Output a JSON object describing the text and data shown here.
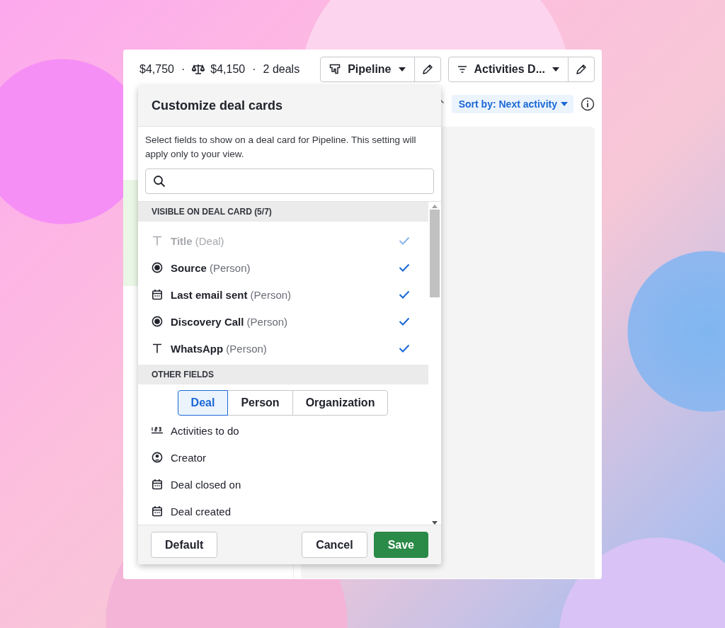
{
  "toolbar": {
    "summary": [
      {
        "text": "$4,750",
        "kind": "plain"
      },
      {
        "text": "$4,150",
        "kind": "weighted"
      },
      {
        "text": "2 deals",
        "kind": "plain"
      }
    ],
    "separators": [
      "·",
      "·"
    ],
    "view_button": {
      "label": "Pipeline"
    },
    "filter_button": {
      "label": "Activities D..."
    }
  },
  "sort": {
    "label": "Sort by: Next activity"
  },
  "dialog": {
    "title": "Customize deal cards",
    "description": "Select fields to show on a deal card for Pipeline. This setting will apply only to your view.",
    "visible_heading": "VISIBLE ON DEAL CARD (5/7)",
    "visible_fields": [
      {
        "name": "Title",
        "source": "(Deal)",
        "kind": "text",
        "checked": true,
        "disabled": true
      },
      {
        "name": "Source",
        "source": "(Person)",
        "kind": "option",
        "checked": true,
        "disabled": false
      },
      {
        "name": "Last email sent",
        "source": "(Person)",
        "kind": "date",
        "checked": true,
        "disabled": false
      },
      {
        "name": "Discovery Call",
        "source": "(Person)",
        "kind": "option",
        "checked": true,
        "disabled": false
      },
      {
        "name": "WhatsApp",
        "source": "(Person)",
        "kind": "text",
        "checked": true,
        "disabled": false
      }
    ],
    "other_heading": "OTHER FIELDS",
    "tabs": [
      {
        "label": "Deal",
        "selected": true
      },
      {
        "label": "Person",
        "selected": false
      },
      {
        "label": "Organization",
        "selected": false
      }
    ],
    "other_fields": [
      {
        "name": "Activities to do",
        "kind": "number"
      },
      {
        "name": "Creator",
        "kind": "user"
      },
      {
        "name": "Deal closed on",
        "kind": "date"
      },
      {
        "name": "Deal created",
        "kind": "date"
      }
    ],
    "buttons": [
      {
        "label": "Default",
        "kind": "secondary"
      },
      {
        "label": "Cancel",
        "kind": "secondary"
      },
      {
        "label": "Save",
        "kind": "primary"
      }
    ]
  }
}
